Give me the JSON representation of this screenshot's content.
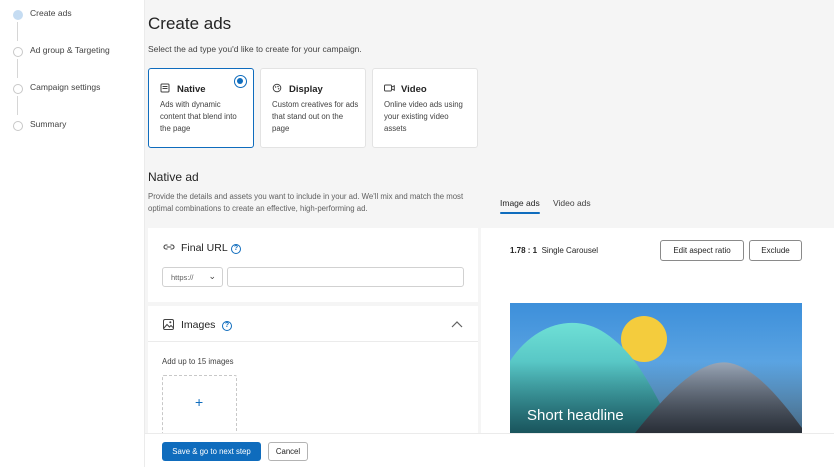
{
  "steps": [
    {
      "label": "Create ads"
    },
    {
      "label": "Ad group & Targeting"
    },
    {
      "label": "Campaign settings"
    },
    {
      "label": "Summary"
    }
  ],
  "header": {
    "title": "Create ads",
    "subtitle": "Select the ad type you'd like to create for your campaign."
  },
  "ad_types": [
    {
      "title": "Native",
      "desc": "Ads with dynamic content that blend into the page",
      "icon": "native-ad-icon",
      "selected": true
    },
    {
      "title": "Display",
      "desc": "Custom creatives for ads that stand out on the page",
      "icon": "display-ad-icon",
      "selected": false
    },
    {
      "title": "Video",
      "desc": "Online video ads using your existing video assets",
      "icon": "video-icon",
      "selected": false
    }
  ],
  "native": {
    "title": "Native ad",
    "desc": "Provide the details and assets you want to include in your ad. We'll mix and match the most optimal combinations to create an effective, high-performing ad."
  },
  "final_url": {
    "title": "Final URL",
    "protocol": "https://",
    "value": ""
  },
  "images": {
    "title": "Images",
    "add_label": "Add up to 15 images"
  },
  "preview": {
    "tabs": [
      "Image ads",
      "Video ads"
    ],
    "active_tab": "Image ads",
    "ratio": "1.78 : 1",
    "layout": "Single Carousel",
    "edit_ratio_label": "Edit aspect ratio",
    "exclude_label": "Exclude",
    "headline": "Short headline"
  },
  "footer": {
    "primary_label": "Save & go to next step",
    "cancel_label": "Cancel"
  },
  "colors": {
    "accent": "#0f6cbd",
    "background": "#f5f5f5"
  }
}
